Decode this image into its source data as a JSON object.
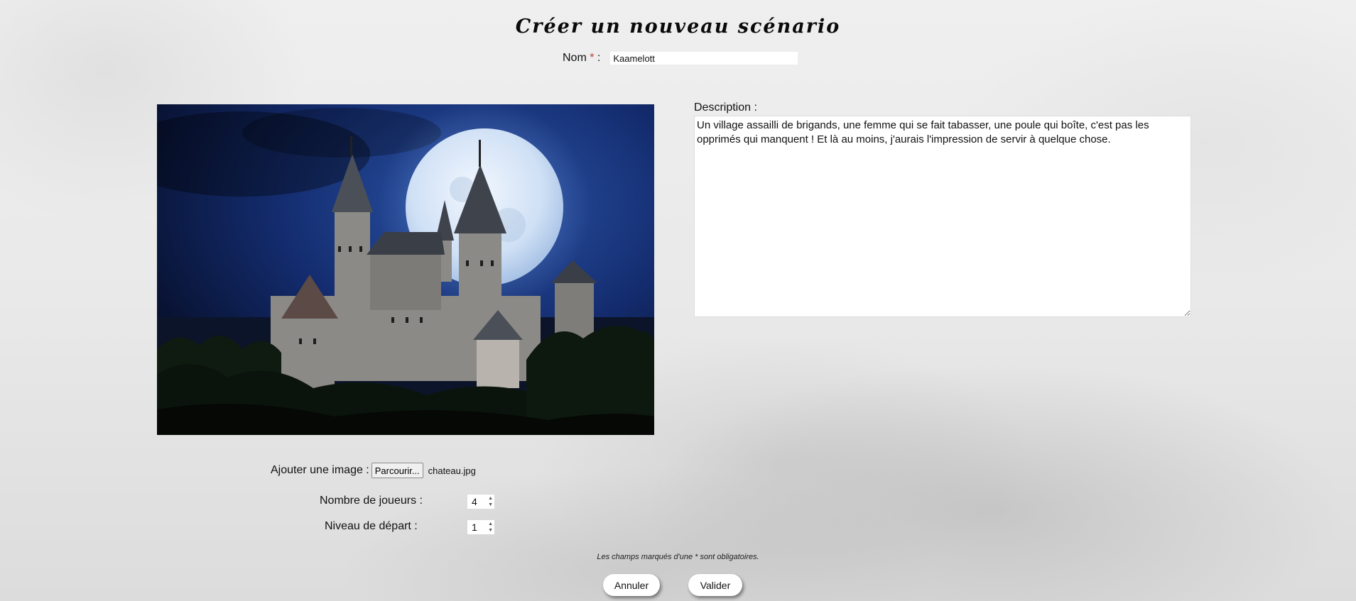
{
  "page": {
    "title": "Créer un nouveau scénario"
  },
  "form": {
    "name_label": "Nom",
    "name_required_mark": "*",
    "name_label_suffix": " :",
    "name_value": "Kaamelott",
    "description_label": "Description :",
    "description_value": "Un village assailli de brigands, une femme qui se fait tabasser, une poule qui boîte, c'est pas les opprimés qui manquent ! Et là au moins, j'aurais l'impression de servir à quelque chose.",
    "image_label": "Ajouter une image :",
    "browse_button": "Parcourir...",
    "file_name": "chateau.jpg",
    "players_label": "Nombre de joueurs :",
    "players_value": "4",
    "level_label": "Niveau de départ :",
    "level_value": "1",
    "mandatory_note": "Les champs marqués d'une * sont obligatoires.",
    "cancel_button": "Annuler",
    "submit_button": "Valider"
  },
  "colors": {
    "required_mark": "#c0392b",
    "image_sky": "#0c1a3e"
  }
}
